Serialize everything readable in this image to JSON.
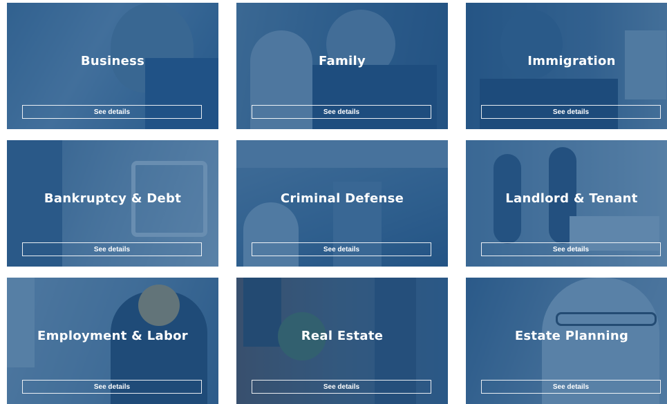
{
  "cards": [
    {
      "title": "Business",
      "button": "See details"
    },
    {
      "title": "Family",
      "button": "See details"
    },
    {
      "title": "Immigration",
      "button": "See details"
    },
    {
      "title": "Bankruptcy & Debt",
      "button": "See details"
    },
    {
      "title": "Criminal Defense",
      "button": "See details"
    },
    {
      "title": "Landlord & Tenant",
      "button": "See details"
    },
    {
      "title": "Employment & Labor",
      "button": "See details"
    },
    {
      "title": "Real Estate",
      "button": "See details"
    },
    {
      "title": "Estate Planning",
      "button": "See details"
    }
  ],
  "colors": {
    "overlay": "#1e568c",
    "text": "#ffffff"
  }
}
